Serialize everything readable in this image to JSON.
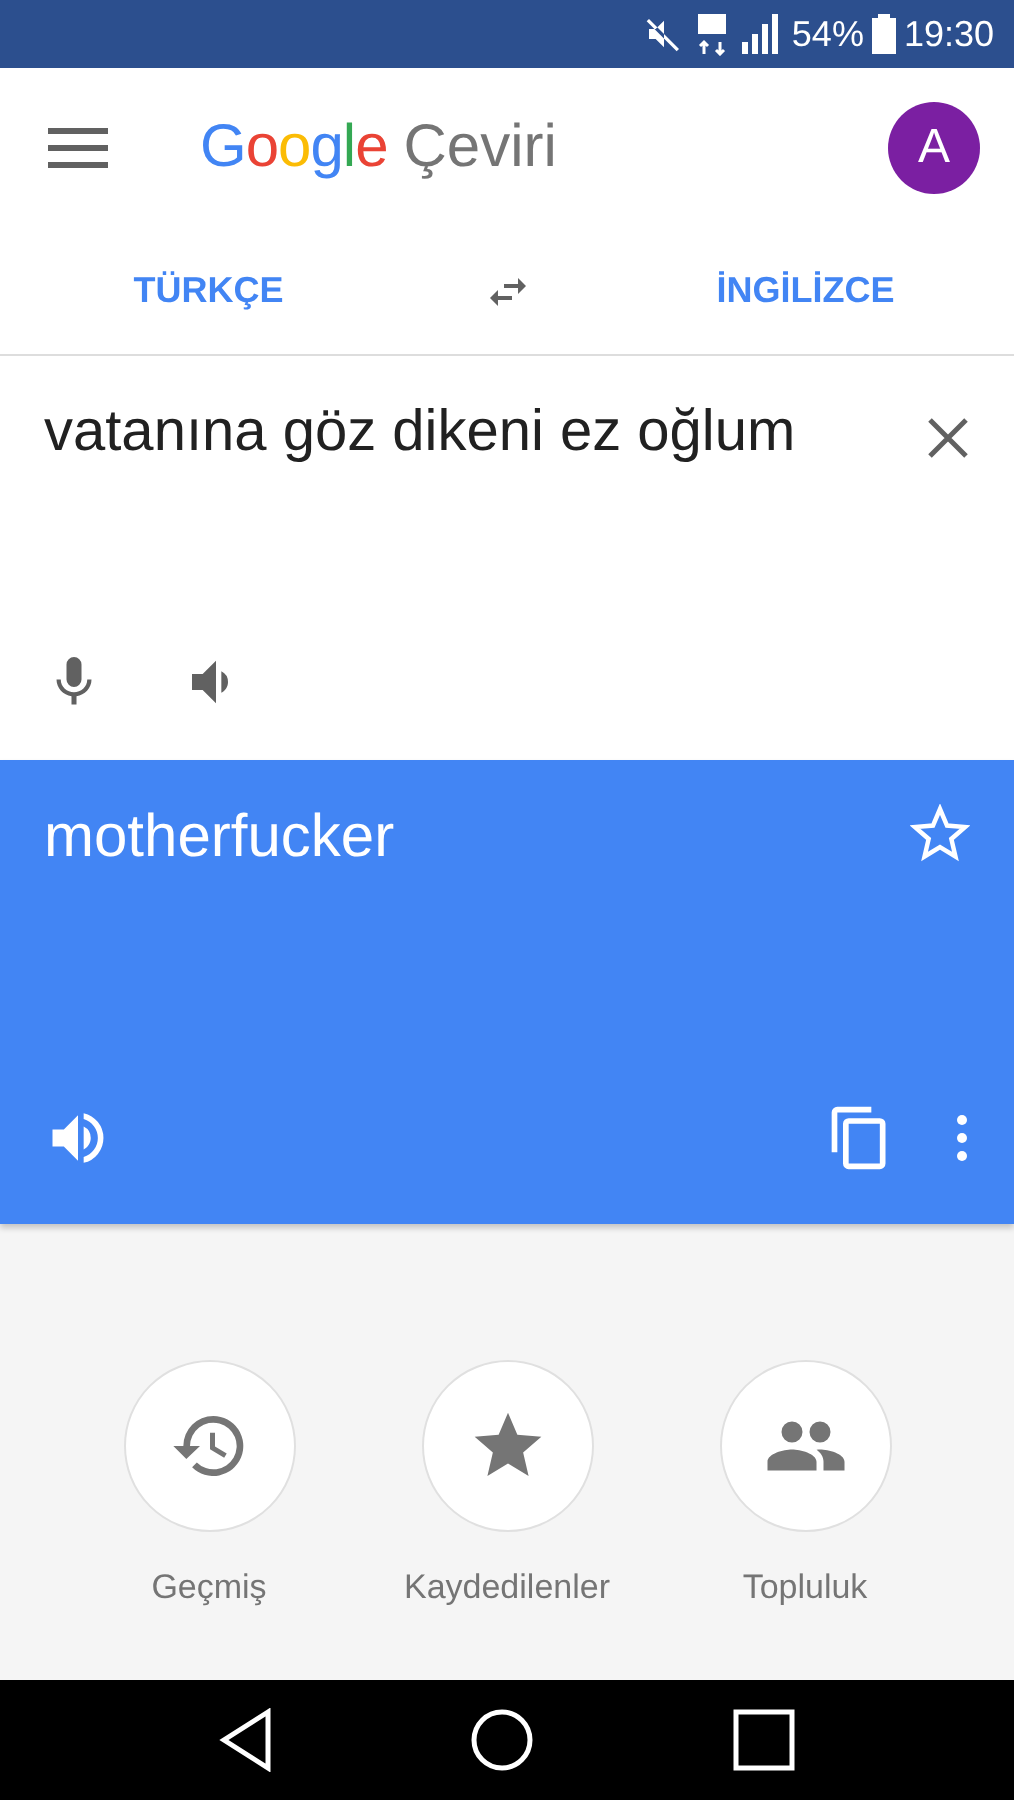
{
  "status_bar": {
    "battery": "54%",
    "time": "19:30"
  },
  "app_bar": {
    "brand": "Google",
    "title": "Çeviri",
    "avatar": "A"
  },
  "languages": {
    "source": "TÜRKÇE",
    "target": "İNGİLİZCE"
  },
  "input": {
    "value": "vatanına göz dikeni ez oğlum"
  },
  "output": {
    "text": "motherfucker",
    "starred": false
  },
  "shortcuts": [
    {
      "label": "Geçmiş"
    },
    {
      "label": "Kaydedilenler"
    },
    {
      "label": "Topluluk"
    }
  ]
}
